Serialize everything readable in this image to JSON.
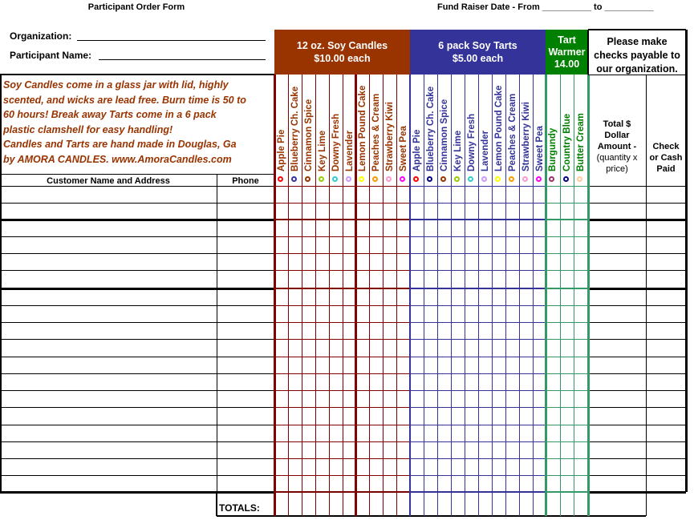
{
  "header": {
    "title": "Participant Order Form",
    "fund_raiser_date": "Fund Raiser Date - From __________ to __________",
    "organization_label": "Organization:",
    "participant_label": "Participant Name:"
  },
  "promo_text": [
    "Soy Candles come in a glass jar with lid, highly",
    "scented, and wicks are lead free.  Burn time is 50 to",
    "60 hours!  Break away Tarts come in a 6 pack",
    "plastic clamshell for easy handling!",
    "Candles and Tarts are hand made in Douglas, Ga",
    "by AMORA CANDLES. www.AmoraCandles.com"
  ],
  "columns": {
    "customer": "Customer Name and Address",
    "phone": "Phone",
    "total_lines": [
      "Total $",
      "Dollar",
      "Amount -",
      "(quantity x",
      "price)"
    ],
    "check_lines": [
      "Check",
      "or Cash",
      "Paid"
    ],
    "payable_lines": [
      "Please make",
      "checks payable to",
      "our organization."
    ]
  },
  "groups": {
    "candles": {
      "line1": "12 oz. Soy Candles",
      "line2": "$10.00 each",
      "color": "#993300",
      "grid": "#800000"
    },
    "tarts": {
      "line1": "6 pack Soy Tarts",
      "line2": "$5.00 each",
      "color": "#333399",
      "grid": "#333399"
    },
    "warmer": {
      "line1": "Tart",
      "line2": "Warmer",
      "line3": "14.00",
      "color": "#008000",
      "grid": "#339966"
    }
  },
  "scents": [
    {
      "name": "Apple Pie",
      "dot": "#ff0000"
    },
    {
      "name": "Blueberry Ch. Cake",
      "dot": "#333399"
    },
    {
      "name": "Cinnamon Spice",
      "dot": "#993300"
    },
    {
      "name": "Key Lime",
      "dot": "#99cc00"
    },
    {
      "name": "Downy Fresh",
      "dot": "#33cccc"
    },
    {
      "name": "Lavender",
      "dot": "#cc99ff"
    },
    {
      "name": "Lemon Pound Cake",
      "dot": "#ffff00"
    },
    {
      "name": "Peaches & Cream",
      "dot": "#ff9900"
    },
    {
      "name": "Strawberry Kiwi",
      "dot": "#ff99cc"
    },
    {
      "name": "Sweet Pea",
      "dot": "#ff00ff"
    }
  ],
  "tart_scents": [
    {
      "name": "Apple Pie",
      "dot": "#ff0000"
    },
    {
      "name": "Blueberry Ch. Cake",
      "dot": "#000080"
    },
    {
      "name": "Cinnamon Spice",
      "dot": "#993300"
    },
    {
      "name": "Key Lime",
      "dot": "#99cc00"
    },
    {
      "name": "Downy Fresh",
      "dot": "#33cccc"
    },
    {
      "name": "Lavender",
      "dot": "#cc99ff"
    },
    {
      "name": "Lemon Pound Cake",
      "dot": "#ffff00"
    },
    {
      "name": "Peaches & Cream",
      "dot": "#ff9900"
    },
    {
      "name": "Strawberry Kiwi",
      "dot": "#ff99cc"
    },
    {
      "name": "Sweet Pea",
      "dot": "#ff00ff"
    }
  ],
  "warmers": [
    {
      "name": "Burgundy",
      "dot": "#993366"
    },
    {
      "name": "Country Blue",
      "dot": "#000080"
    },
    {
      "name": "Butter Cream",
      "dot": "#ffcc99"
    }
  ],
  "totals_label": "TOTALS:",
  "row_count": 18
}
